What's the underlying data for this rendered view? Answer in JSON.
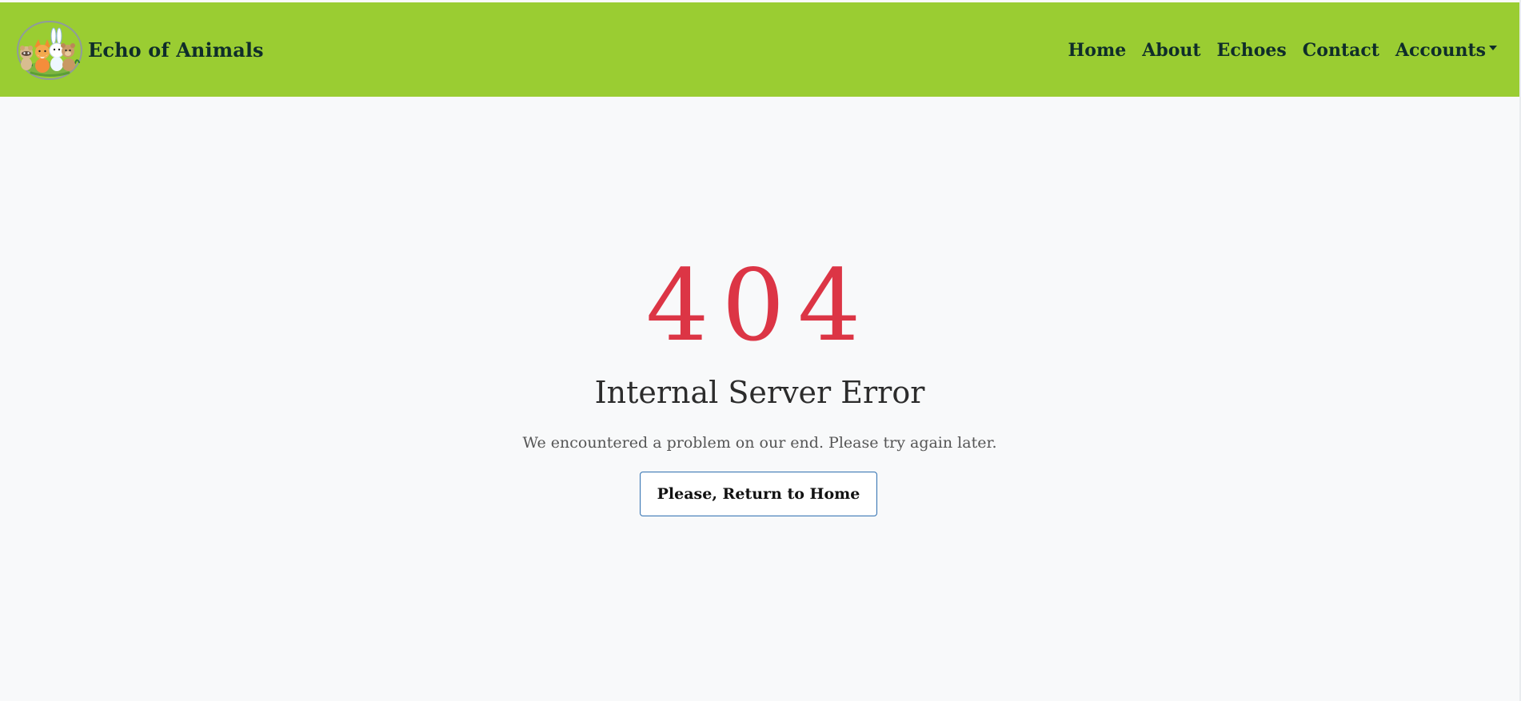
{
  "navbar": {
    "brand_name": "Echo of Animals",
    "links": [
      {
        "label": "Home"
      },
      {
        "label": "About"
      },
      {
        "label": "Echoes"
      },
      {
        "label": "Contact"
      },
      {
        "label": "Accounts"
      }
    ]
  },
  "error": {
    "code": "404",
    "title": "Internal Server Error",
    "message": "We encountered a problem on our end. Please try again later.",
    "button_label": "Please, Return to Home"
  },
  "colors": {
    "navbar_bg": "#9acd32",
    "brand_text": "#0f2d2a",
    "error_code": "#dc3545",
    "page_bg": "#f8f9fa",
    "button_border": "#2f6fb0"
  },
  "icons": {
    "logo": "animal-friends-logo",
    "dropdown": "caret-down-icon"
  }
}
